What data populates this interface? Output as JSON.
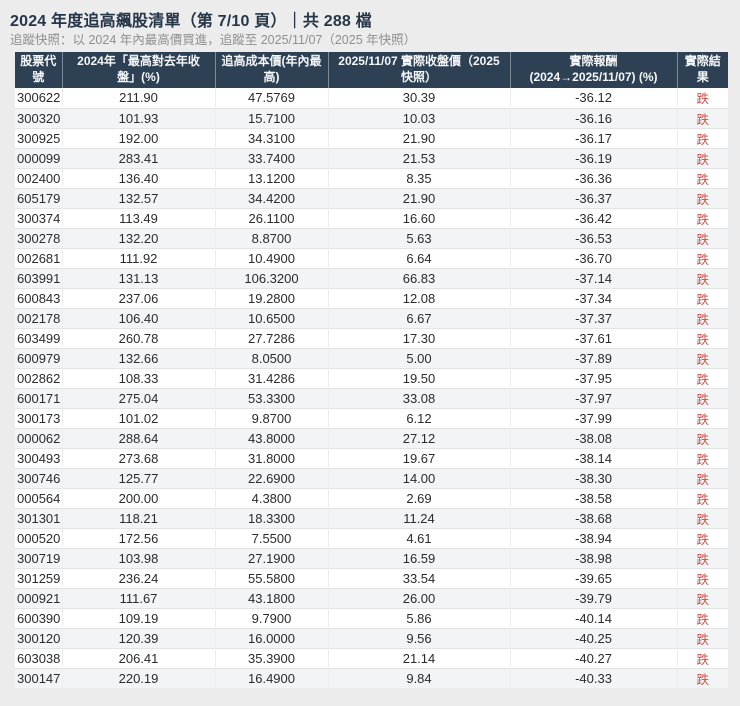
{
  "page": {
    "title": "2024 年度追高飆股清單（第 7/10 頁）｜共 288 檔",
    "subtitle": "追蹤快照：以 2024 年內最高價買進，追蹤至 2025/11/07（2025 年快照）"
  },
  "colors": {
    "header_bg": "#2e4053",
    "header_text": "#f5f7f9",
    "result_down_red": "#cd5047",
    "page_bg": "#ececec",
    "stripe_bg": "#f3f4f6"
  },
  "table": {
    "columns": [
      "股票代\n號",
      "2024年「最高對去年收\n盤」(%)",
      "追高成本價(年內最\n高)",
      "2025/11/07 實際收盤價（2025\n快照）",
      "實際報酬\n(2024→2025/11/07) (%)",
      "實際結\n果"
    ],
    "rows": [
      [
        "300622",
        "211.90",
        "47.5769",
        "30.39",
        "-36.12",
        "跌"
      ],
      [
        "300320",
        "101.93",
        "15.7100",
        "10.03",
        "-36.16",
        "跌"
      ],
      [
        "300925",
        "192.00",
        "34.3100",
        "21.90",
        "-36.17",
        "跌"
      ],
      [
        "000099",
        "283.41",
        "33.7400",
        "21.53",
        "-36.19",
        "跌"
      ],
      [
        "002400",
        "136.40",
        "13.1200",
        "8.35",
        "-36.36",
        "跌"
      ],
      [
        "605179",
        "132.57",
        "34.4200",
        "21.90",
        "-36.37",
        "跌"
      ],
      [
        "300374",
        "113.49",
        "26.1100",
        "16.60",
        "-36.42",
        "跌"
      ],
      [
        "300278",
        "132.20",
        "8.8700",
        "5.63",
        "-36.53",
        "跌"
      ],
      [
        "002681",
        "111.92",
        "10.4900",
        "6.64",
        "-36.70",
        "跌"
      ],
      [
        "603991",
        "131.13",
        "106.3200",
        "66.83",
        "-37.14",
        "跌"
      ],
      [
        "600843",
        "237.06",
        "19.2800",
        "12.08",
        "-37.34",
        "跌"
      ],
      [
        "002178",
        "106.40",
        "10.6500",
        "6.67",
        "-37.37",
        "跌"
      ],
      [
        "603499",
        "260.78",
        "27.7286",
        "17.30",
        "-37.61",
        "跌"
      ],
      [
        "600979",
        "132.66",
        "8.0500",
        "5.00",
        "-37.89",
        "跌"
      ],
      [
        "002862",
        "108.33",
        "31.4286",
        "19.50",
        "-37.95",
        "跌"
      ],
      [
        "600171",
        "275.04",
        "53.3300",
        "33.08",
        "-37.97",
        "跌"
      ],
      [
        "300173",
        "101.02",
        "9.8700",
        "6.12",
        "-37.99",
        "跌"
      ],
      [
        "000062",
        "288.64",
        "43.8000",
        "27.12",
        "-38.08",
        "跌"
      ],
      [
        "300493",
        "273.68",
        "31.8000",
        "19.67",
        "-38.14",
        "跌"
      ],
      [
        "300746",
        "125.77",
        "22.6900",
        "14.00",
        "-38.30",
        "跌"
      ],
      [
        "000564",
        "200.00",
        "4.3800",
        "2.69",
        "-38.58",
        "跌"
      ],
      [
        "301301",
        "118.21",
        "18.3300",
        "11.24",
        "-38.68",
        "跌"
      ],
      [
        "000520",
        "172.56",
        "7.5500",
        "4.61",
        "-38.94",
        "跌"
      ],
      [
        "300719",
        "103.98",
        "27.1900",
        "16.59",
        "-38.98",
        "跌"
      ],
      [
        "301259",
        "236.24",
        "55.5800",
        "33.54",
        "-39.65",
        "跌"
      ],
      [
        "000921",
        "111.67",
        "43.1800",
        "26.00",
        "-39.79",
        "跌"
      ],
      [
        "600390",
        "109.19",
        "9.7900",
        "5.86",
        "-40.14",
        "跌"
      ],
      [
        "300120",
        "120.39",
        "16.0000",
        "9.56",
        "-40.25",
        "跌"
      ],
      [
        "603038",
        "206.41",
        "35.3900",
        "21.14",
        "-40.27",
        "跌"
      ],
      [
        "300147",
        "220.19",
        "16.4900",
        "9.84",
        "-40.33",
        "跌"
      ]
    ]
  }
}
